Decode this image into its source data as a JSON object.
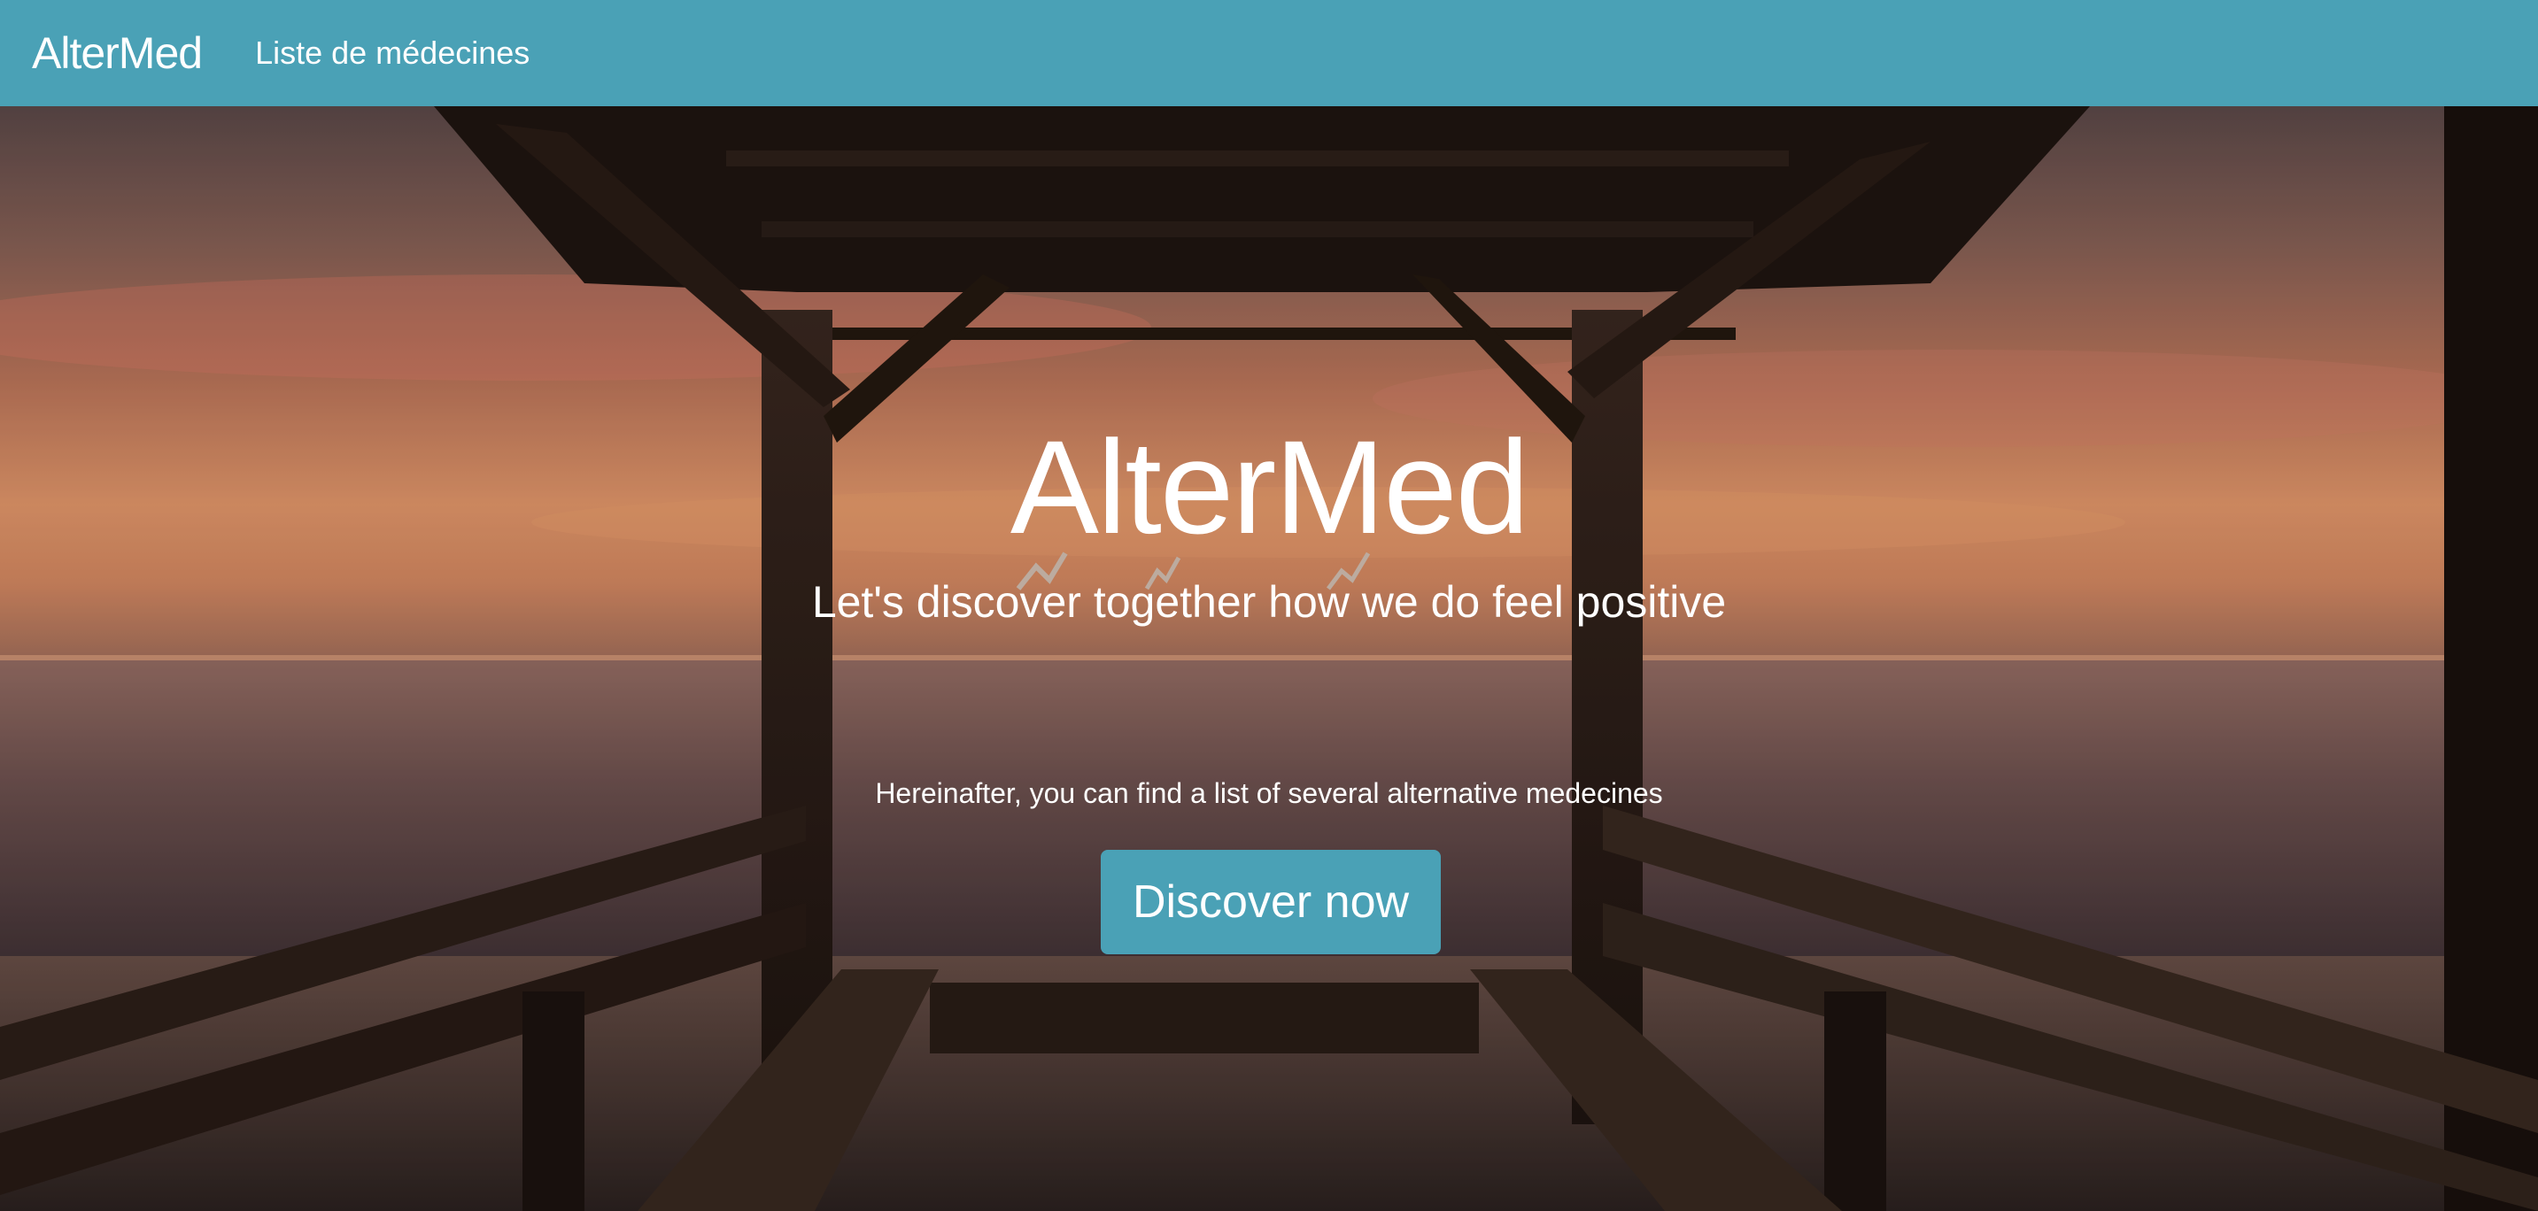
{
  "navbar": {
    "brand": "AlterMed",
    "links": [
      "Liste de médecines"
    ]
  },
  "hero": {
    "title": "AlterMed",
    "subtitle": "Let's discover together how we do feel positive",
    "text": "Hereinafter, you can find a list of several alternative medecines",
    "button_label": "Discover now"
  },
  "colors": {
    "navbar_bg": "#4aa1b6",
    "button_bg": "#4aa1b6",
    "text": "#ffffff"
  }
}
